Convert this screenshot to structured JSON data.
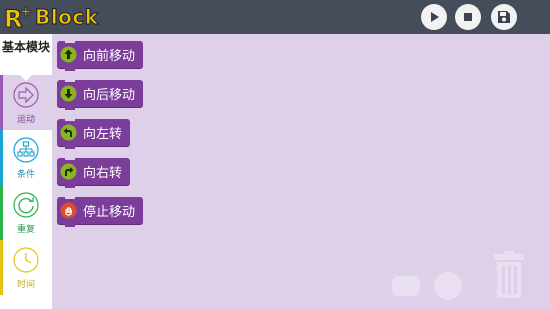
{
  "app": {
    "logo_text": "Block"
  },
  "toolbar": {
    "play": "play-icon",
    "stop": "stop-icon",
    "save": "save-icon"
  },
  "sidebar": {
    "title": "基本模块",
    "categories": [
      {
        "label": "运动",
        "icon": "arrow-right-icon",
        "color": "#9b59b6"
      },
      {
        "label": "条件",
        "icon": "hierarchy-icon",
        "color": "#1aa3d6"
      },
      {
        "label": "重复",
        "icon": "repeat-icon",
        "color": "#2bb34a"
      },
      {
        "label": "时间",
        "icon": "clock-icon",
        "color": "#e3c316"
      }
    ]
  },
  "blocks": [
    {
      "label": "向前移动",
      "icon": "arrow-up-icon"
    },
    {
      "label": "向后移动",
      "icon": "arrow-down-icon"
    },
    {
      "label": "向左转",
      "icon": "turn-left-icon"
    },
    {
      "label": "向右转",
      "icon": "turn-right-icon"
    },
    {
      "label": "停止移动",
      "icon": "stop-hand-icon"
    }
  ],
  "colors": {
    "topbar": "#454d5b",
    "workspace": "#ddd0e8",
    "block": "#7b3c9a",
    "block_icon": "#8ab51e",
    "stop_icon": "#e24b2b"
  }
}
